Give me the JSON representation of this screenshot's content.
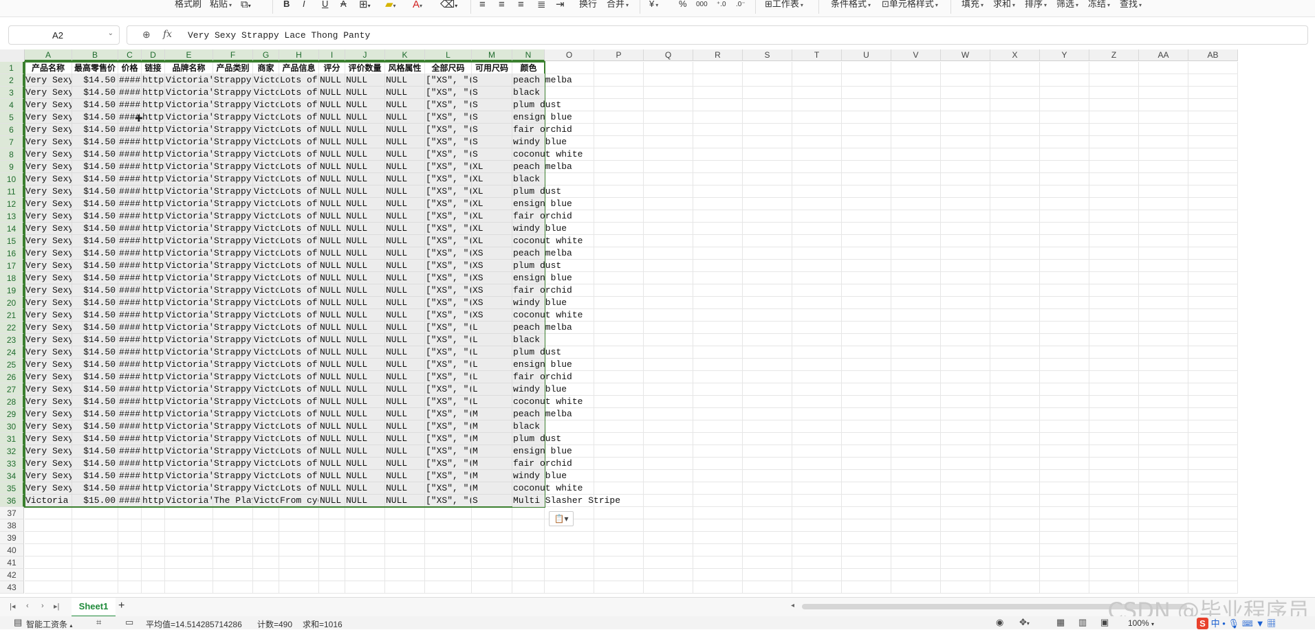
{
  "ribbon": {
    "format_painter": "格式刷",
    "paste": "粘贴",
    "bold": "B",
    "italic": "I",
    "underline": "U",
    "strike": "A",
    "wrap": "换行",
    "merge": "合并",
    "currency": "¥",
    "percent": "%",
    "worksheet": "工作表",
    "cond_format": "条件格式",
    "cell_style": "单元格样式",
    "fill": "填充",
    "sum": "求和",
    "sort": "排序",
    "filter": "筛选",
    "freeze": "冻结",
    "find": "查找"
  },
  "formula_bar": {
    "name_box": "A2",
    "fx": "fx",
    "formula": "Very Sexy Strappy Lace Thong Panty"
  },
  "columns": [
    "A",
    "B",
    "C",
    "D",
    "E",
    "F",
    "G",
    "H",
    "I",
    "J",
    "K",
    "L",
    "M",
    "N",
    "O",
    "P",
    "Q",
    "R",
    "S",
    "T",
    "U",
    "V",
    "W",
    "X",
    "Y",
    "Z",
    "AA",
    "AB"
  ],
  "header_row": [
    "产品名称",
    "最高零售价",
    "价格",
    "链接",
    "品牌名称",
    "产品类别",
    "商家",
    "产品信息",
    "评分",
    "评价数量",
    "风格属性",
    "全部尺码",
    "可用尺码",
    "颜色"
  ],
  "rows": [
    [
      "Very Sexy",
      "$14.50",
      "####",
      "https",
      "Victoria'",
      "Strappy I",
      "Victo",
      "Lots of (",
      "NULL",
      "NULL",
      "NULL",
      "[\"XS\", \"(",
      "S",
      "peach melba"
    ],
    [
      "Very Sexy",
      "$14.50",
      "####",
      "https",
      "Victoria'",
      "Strappy I",
      "Victo",
      "Lots of (",
      "NULL",
      "NULL",
      "NULL",
      "[\"XS\", \"(",
      "S",
      "black"
    ],
    [
      "Very Sexy",
      "$14.50",
      "####",
      "https",
      "Victoria'",
      "Strappy I",
      "Victo",
      "Lots of (",
      "NULL",
      "NULL",
      "NULL",
      "[\"XS\", \"(",
      "S",
      "plum dust"
    ],
    [
      "Very Sexy",
      "$14.50",
      "####",
      "https",
      "Victoria'",
      "Strappy I",
      "Victo",
      "Lots of (",
      "NULL",
      "NULL",
      "NULL",
      "[\"XS\", \"(",
      "S",
      "ensign blue"
    ],
    [
      "Very Sexy",
      "$14.50",
      "####",
      "https",
      "Victoria'",
      "Strappy I",
      "Victo",
      "Lots of (",
      "NULL",
      "NULL",
      "NULL",
      "[\"XS\", \"(",
      "S",
      "fair orchid"
    ],
    [
      "Very Sexy",
      "$14.50",
      "####",
      "https",
      "Victoria'",
      "Strappy I",
      "Victo",
      "Lots of (",
      "NULL",
      "NULL",
      "NULL",
      "[\"XS\", \"(",
      "S",
      "windy blue"
    ],
    [
      "Very Sexy",
      "$14.50",
      "####",
      "https",
      "Victoria'",
      "Strappy I",
      "Victo",
      "Lots of (",
      "NULL",
      "NULL",
      "NULL",
      "[\"XS\", \"(",
      "S",
      "coconut white"
    ],
    [
      "Very Sexy",
      "$14.50",
      "####",
      "https",
      "Victoria'",
      "Strappy I",
      "Victo",
      "Lots of (",
      "NULL",
      "NULL",
      "NULL",
      "[\"XS\", \"(",
      "XL",
      "peach melba"
    ],
    [
      "Very Sexy",
      "$14.50",
      "####",
      "https",
      "Victoria'",
      "Strappy I",
      "Victo",
      "Lots of (",
      "NULL",
      "NULL",
      "NULL",
      "[\"XS\", \"(",
      "XL",
      "black"
    ],
    [
      "Very Sexy",
      "$14.50",
      "####",
      "https",
      "Victoria'",
      "Strappy I",
      "Victo",
      "Lots of (",
      "NULL",
      "NULL",
      "NULL",
      "[\"XS\", \"(",
      "XL",
      "plum dust"
    ],
    [
      "Very Sexy",
      "$14.50",
      "####",
      "https",
      "Victoria'",
      "Strappy I",
      "Victo",
      "Lots of (",
      "NULL",
      "NULL",
      "NULL",
      "[\"XS\", \"(",
      "XL",
      "ensign blue"
    ],
    [
      "Very Sexy",
      "$14.50",
      "####",
      "https",
      "Victoria'",
      "Strappy I",
      "Victo",
      "Lots of (",
      "NULL",
      "NULL",
      "NULL",
      "[\"XS\", \"(",
      "XL",
      "fair orchid"
    ],
    [
      "Very Sexy",
      "$14.50",
      "####",
      "https",
      "Victoria'",
      "Strappy I",
      "Victo",
      "Lots of (",
      "NULL",
      "NULL",
      "NULL",
      "[\"XS\", \"(",
      "XL",
      "windy blue"
    ],
    [
      "Very Sexy",
      "$14.50",
      "####",
      "https",
      "Victoria'",
      "Strappy I",
      "Victo",
      "Lots of (",
      "NULL",
      "NULL",
      "NULL",
      "[\"XS\", \"(",
      "XL",
      "coconut white"
    ],
    [
      "Very Sexy",
      "$14.50",
      "####",
      "https",
      "Victoria'",
      "Strappy I",
      "Victo",
      "Lots of (",
      "NULL",
      "NULL",
      "NULL",
      "[\"XS\", \"(",
      "XS",
      "peach melba"
    ],
    [
      "Very Sexy",
      "$14.50",
      "####",
      "https",
      "Victoria'",
      "Strappy I",
      "Victo",
      "Lots of (",
      "NULL",
      "NULL",
      "NULL",
      "[\"XS\", \"(",
      "XS",
      "plum dust"
    ],
    [
      "Very Sexy",
      "$14.50",
      "####",
      "https",
      "Victoria'",
      "Strappy I",
      "Victo",
      "Lots of (",
      "NULL",
      "NULL",
      "NULL",
      "[\"XS\", \"(",
      "XS",
      "ensign blue"
    ],
    [
      "Very Sexy",
      "$14.50",
      "####",
      "https",
      "Victoria'",
      "Strappy I",
      "Victo",
      "Lots of (",
      "NULL",
      "NULL",
      "NULL",
      "[\"XS\", \"(",
      "XS",
      "fair orchid"
    ],
    [
      "Very Sexy",
      "$14.50",
      "####",
      "https",
      "Victoria'",
      "Strappy I",
      "Victo",
      "Lots of (",
      "NULL",
      "NULL",
      "NULL",
      "[\"XS\", \"(",
      "XS",
      "windy blue"
    ],
    [
      "Very Sexy",
      "$14.50",
      "####",
      "https",
      "Victoria'",
      "Strappy I",
      "Victo",
      "Lots of (",
      "NULL",
      "NULL",
      "NULL",
      "[\"XS\", \"(",
      "XS",
      "coconut white"
    ],
    [
      "Very Sexy",
      "$14.50",
      "####",
      "https",
      "Victoria'",
      "Strappy I",
      "Victo",
      "Lots of (",
      "NULL",
      "NULL",
      "NULL",
      "[\"XS\", \"(",
      "L",
      "peach melba"
    ],
    [
      "Very Sexy",
      "$14.50",
      "####",
      "https",
      "Victoria'",
      "Strappy I",
      "Victo",
      "Lots of (",
      "NULL",
      "NULL",
      "NULL",
      "[\"XS\", \"(",
      "L",
      "black"
    ],
    [
      "Very Sexy",
      "$14.50",
      "####",
      "https",
      "Victoria'",
      "Strappy I",
      "Victo",
      "Lots of (",
      "NULL",
      "NULL",
      "NULL",
      "[\"XS\", \"(",
      "L",
      "plum dust"
    ],
    [
      "Very Sexy",
      "$14.50",
      "####",
      "https",
      "Victoria'",
      "Strappy I",
      "Victo",
      "Lots of (",
      "NULL",
      "NULL",
      "NULL",
      "[\"XS\", \"(",
      "L",
      "ensign blue"
    ],
    [
      "Very Sexy",
      "$14.50",
      "####",
      "https",
      "Victoria'",
      "Strappy I",
      "Victo",
      "Lots of (",
      "NULL",
      "NULL",
      "NULL",
      "[\"XS\", \"(",
      "L",
      "fair orchid"
    ],
    [
      "Very Sexy",
      "$14.50",
      "####",
      "https",
      "Victoria'",
      "Strappy I",
      "Victo",
      "Lots of (",
      "NULL",
      "NULL",
      "NULL",
      "[\"XS\", \"(",
      "L",
      "windy blue"
    ],
    [
      "Very Sexy",
      "$14.50",
      "####",
      "https",
      "Victoria'",
      "Strappy I",
      "Victo",
      "Lots of (",
      "NULL",
      "NULL",
      "NULL",
      "[\"XS\", \"(",
      "L",
      "coconut white"
    ],
    [
      "Very Sexy",
      "$14.50",
      "####",
      "https",
      "Victoria'",
      "Strappy I",
      "Victo",
      "Lots of (",
      "NULL",
      "NULL",
      "NULL",
      "[\"XS\", \"(",
      "M",
      "peach melba"
    ],
    [
      "Very Sexy",
      "$14.50",
      "####",
      "https",
      "Victoria'",
      "Strappy I",
      "Victo",
      "Lots of (",
      "NULL",
      "NULL",
      "NULL",
      "[\"XS\", \"(",
      "M",
      "black"
    ],
    [
      "Very Sexy",
      "$14.50",
      "####",
      "https",
      "Victoria'",
      "Strappy I",
      "Victo",
      "Lots of (",
      "NULL",
      "NULL",
      "NULL",
      "[\"XS\", \"(",
      "M",
      "plum dust"
    ],
    [
      "Very Sexy",
      "$14.50",
      "####",
      "https",
      "Victoria'",
      "Strappy I",
      "Victo",
      "Lots of (",
      "NULL",
      "NULL",
      "NULL",
      "[\"XS\", \"(",
      "M",
      "ensign blue"
    ],
    [
      "Very Sexy",
      "$14.50",
      "####",
      "https",
      "Victoria'",
      "Strappy I",
      "Victo",
      "Lots of (",
      "NULL",
      "NULL",
      "NULL",
      "[\"XS\", \"(",
      "M",
      "fair orchid"
    ],
    [
      "Very Sexy",
      "$14.50",
      "####",
      "https",
      "Victoria'",
      "Strappy I",
      "Victo",
      "Lots of (",
      "NULL",
      "NULL",
      "NULL",
      "[\"XS\", \"(",
      "M",
      "windy blue"
    ],
    [
      "Very Sexy",
      "$14.50",
      "####",
      "https",
      "Victoria'",
      "Strappy I",
      "Victo",
      "Lots of (",
      "NULL",
      "NULL",
      "NULL",
      "[\"XS\", \"(",
      "M",
      "coconut white"
    ],
    [
      "Victoria",
      "$15.00",
      "####",
      "https",
      "Victoria'",
      "The Playe",
      "Victo",
      "From cyc",
      "NULL",
      "NULL",
      "NULL",
      "[\"XS\", \"(",
      "S",
      "Multi Slasher Stripe"
    ]
  ],
  "row_numbers": [
    "1",
    "2",
    "3",
    "4",
    "5",
    "6",
    "7",
    "8",
    "9",
    "10",
    "11",
    "12",
    "13",
    "14",
    "15",
    "16",
    "17",
    "18",
    "19",
    "20",
    "21",
    "22",
    "23",
    "24",
    "25",
    "26",
    "27",
    "28",
    "29",
    "30",
    "31",
    "32",
    "33",
    "34",
    "35",
    "36",
    "37",
    "38",
    "39",
    "40",
    "41",
    "42",
    "43"
  ],
  "tabs": {
    "sheet": "Sheet1",
    "add": "+"
  },
  "watermark": "CSDN @毕业程序员",
  "status": {
    "assistant": "智能工资条",
    "average": "平均值=14.514285714286",
    "count": "计数=490",
    "sum": "求和=1016",
    "zoom": "100%",
    "ime": "中"
  },
  "colors": {
    "selection_border": "#3a7f2e",
    "accent": "#1f8a3a"
  }
}
